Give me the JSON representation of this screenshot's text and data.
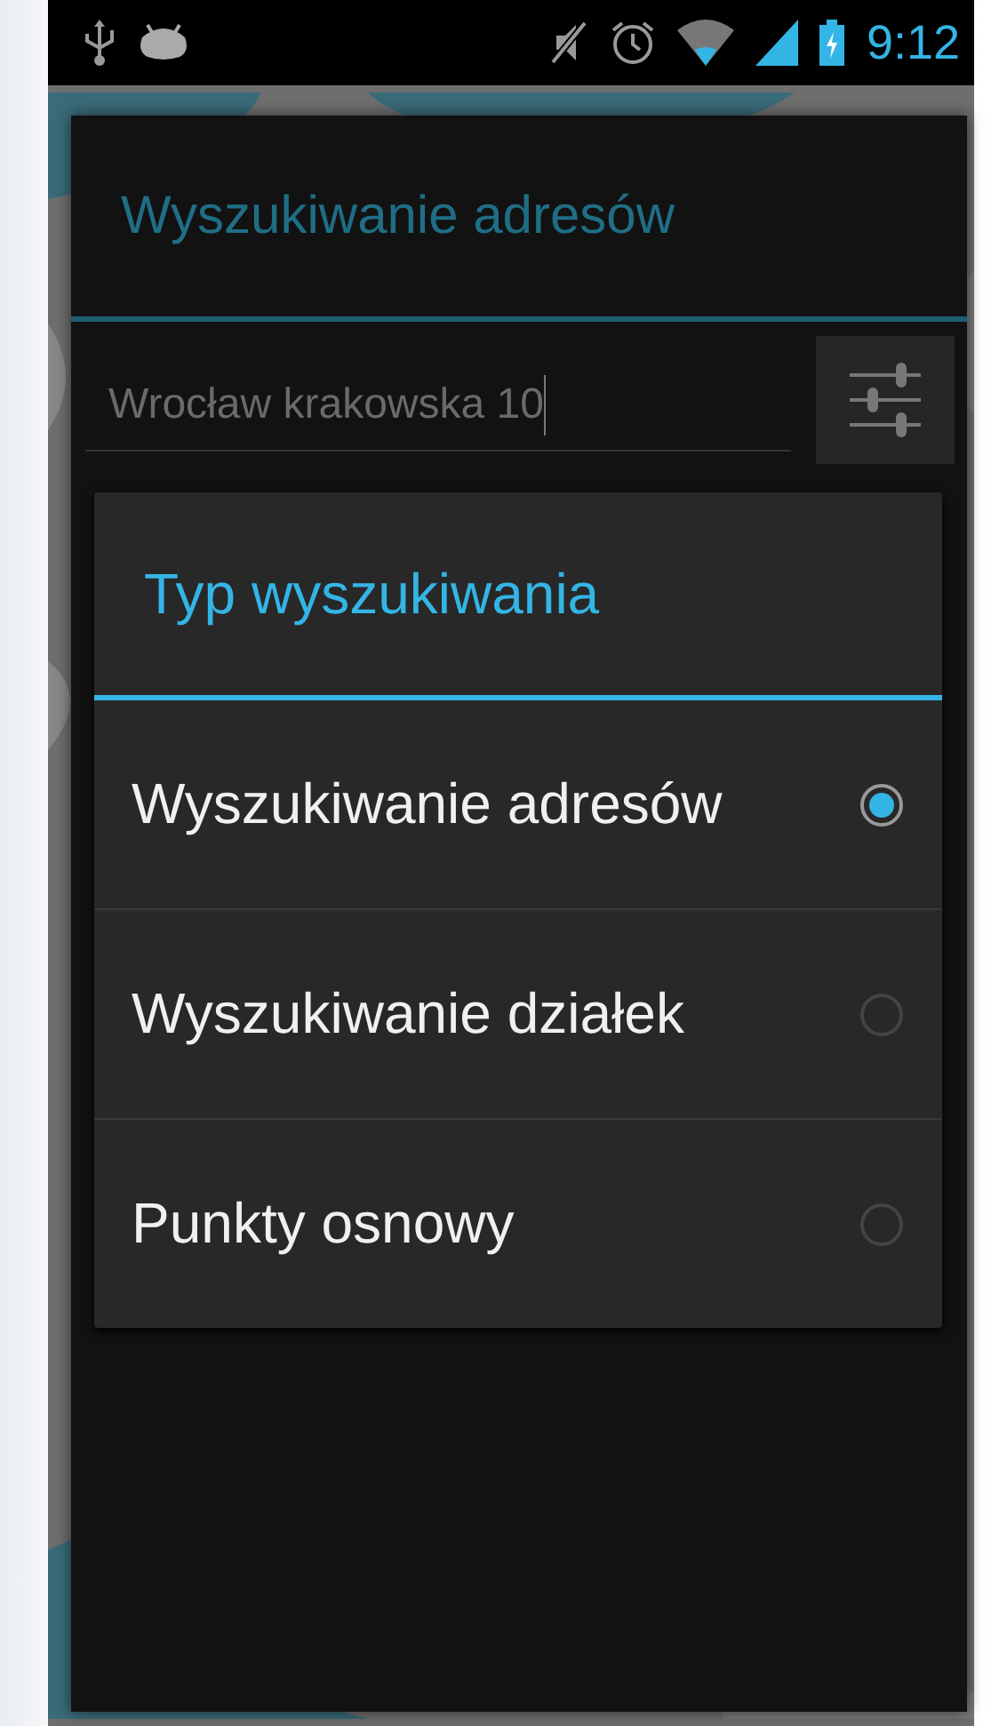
{
  "status_bar": {
    "time": "9:12"
  },
  "search_dialog": {
    "title": "Wyszukiwanie adresów",
    "search_field": {
      "value": "Wrocław krakowska 10"
    }
  },
  "type_dialog": {
    "title": "Typ wyszukiwania",
    "options": [
      {
        "label": "Wyszukiwanie adresów",
        "selected": true
      },
      {
        "label": "Wyszukiwanie działek",
        "selected": false
      },
      {
        "label": "Punkty osnowy",
        "selected": false
      }
    ]
  }
}
